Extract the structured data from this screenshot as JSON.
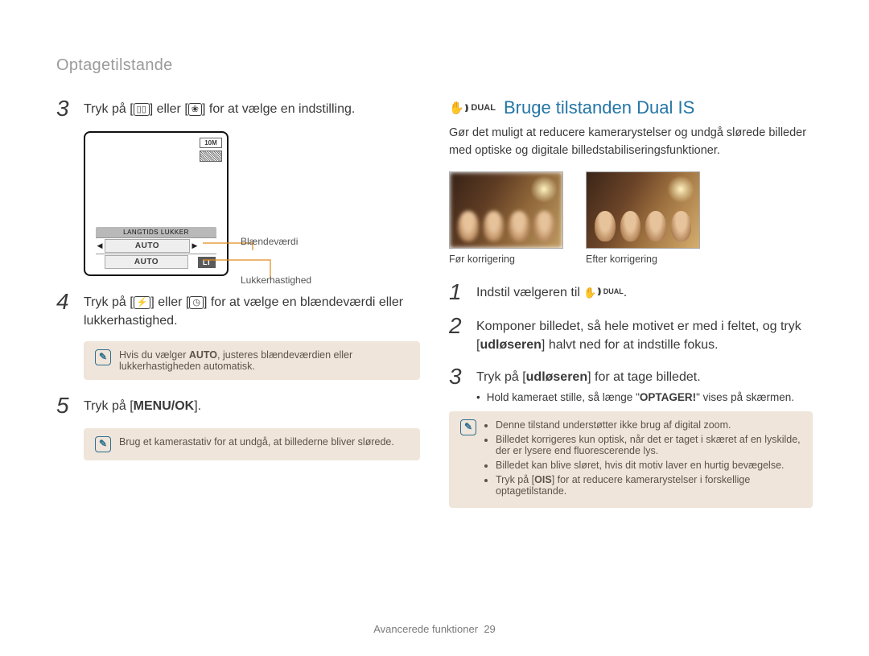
{
  "header": "Optagetilstande",
  "left": {
    "step3_num": "3",
    "step3_text_a": "Tryk på [",
    "step3_text_b": "] eller [",
    "step3_text_c": "] for at vælge en indstilling.",
    "diagram": {
      "badge_10m": "10M",
      "label_langtids": "LANGTIDS LUKKER",
      "auto1": "AUTO",
      "auto2": "AUTO",
      "lt": "LT",
      "callout_aperture": "Blændeværdi",
      "callout_shutter": "Lukkerhastighed"
    },
    "step4_num": "4",
    "step4_text_a": "Tryk på [",
    "step4_text_b": "] eller [",
    "step4_text_c": "] for at vælge en blændeværdi eller lukkerhastighed.",
    "note1_a": "Hvis du vælger ",
    "note1_auto": "AUTO",
    "note1_b": ", justeres blændeværdien eller lukkerhastigheden automatisk.",
    "step5_num": "5",
    "step5_text_a": "Tryk på [",
    "step5_menuok": "MENU/OK",
    "step5_text_b": "].",
    "note2": "Brug et kamerastativ for at undgå, at billederne bliver slørede."
  },
  "right": {
    "dual_label": "DUAL",
    "title": "Bruge tilstanden Dual IS",
    "intro": "Gør det muligt at reducere kamerarystelser og undgå slørede billeder med optiske og digitale billedstabiliseringsfunktioner.",
    "caption_before": "Før korrigering",
    "caption_after": "Efter korrigering",
    "step1_num": "1",
    "step1_text": "Indstil vælgeren til ",
    "step2_num": "2",
    "step2_text_a": "Komponer billedet, så hele motivet er med i feltet, og tryk [",
    "step2_udl": "udløseren",
    "step2_text_b": "] halvt ned for at indstille fokus.",
    "step3_num": "3",
    "step3_text_a": "Tryk på [",
    "step3_udl": "udløseren",
    "step3_text_b": "] for at tage billedet.",
    "step3_sub_a": "Hold kameraet stille, så længe \"",
    "step3_optager": "OPTAGER!",
    "step3_sub_b": "\" vises på skærmen.",
    "note_items": {
      "0": "Denne tilstand understøtter ikke brug af digital zoom.",
      "1": "Billedet korrigeres kun optisk, når det er taget i skæret af en lyskilde, der er lysere end fluorescerende lys.",
      "2": "Billedet kan blive sløret, hvis dit motiv laver en hurtig bevægelse.",
      "3a": "Tryk på [",
      "3_ois": "OIS",
      "3b": "] for at reducere kamerarystelser i forskellige optagetilstande."
    }
  },
  "footer_label": "Avancerede funktioner",
  "footer_page": "29"
}
